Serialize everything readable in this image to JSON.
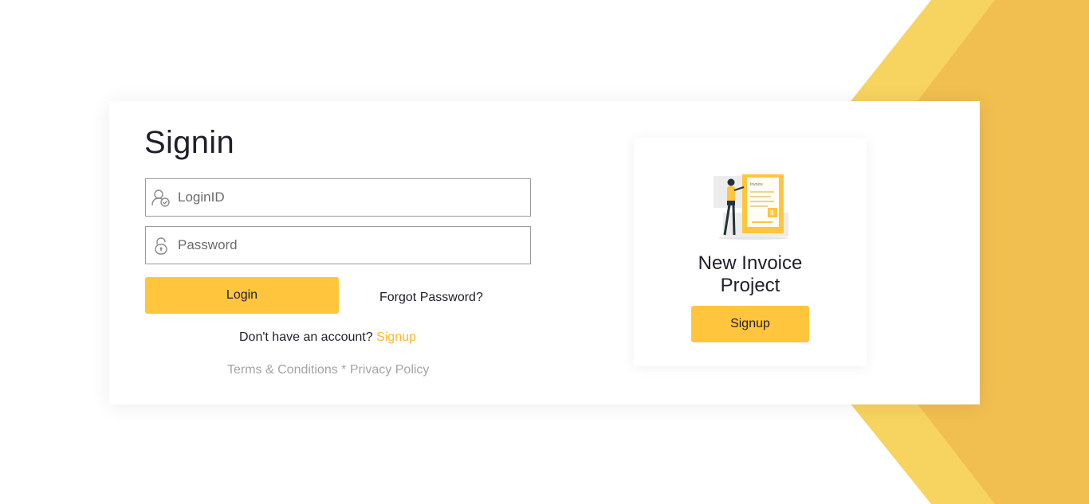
{
  "signin": {
    "title": "Signin",
    "login_placeholder": "LoginID",
    "password_placeholder": "Password",
    "login_button": "Login",
    "forgot_link": "Forgot Password?",
    "no_account_text": "Don't have an account? ",
    "signup_link": "Signup",
    "terms_link": "Terms & Conditions",
    "legal_separator": " * ",
    "privacy_link": "Privacy Policy"
  },
  "promo": {
    "title_line1": "New Invoice",
    "title_line2": "Project",
    "signup_button": "Signup",
    "illustration_text": "Invoice",
    "illustration_currency": "$"
  },
  "colors": {
    "accent": "#ffc53d",
    "link": "#ffb52e",
    "background_shape_light": "#f7d35f",
    "background_shape_dark": "#f1be50"
  },
  "icons": {
    "login_field": "user-check-icon",
    "password_field": "lock-icon"
  }
}
